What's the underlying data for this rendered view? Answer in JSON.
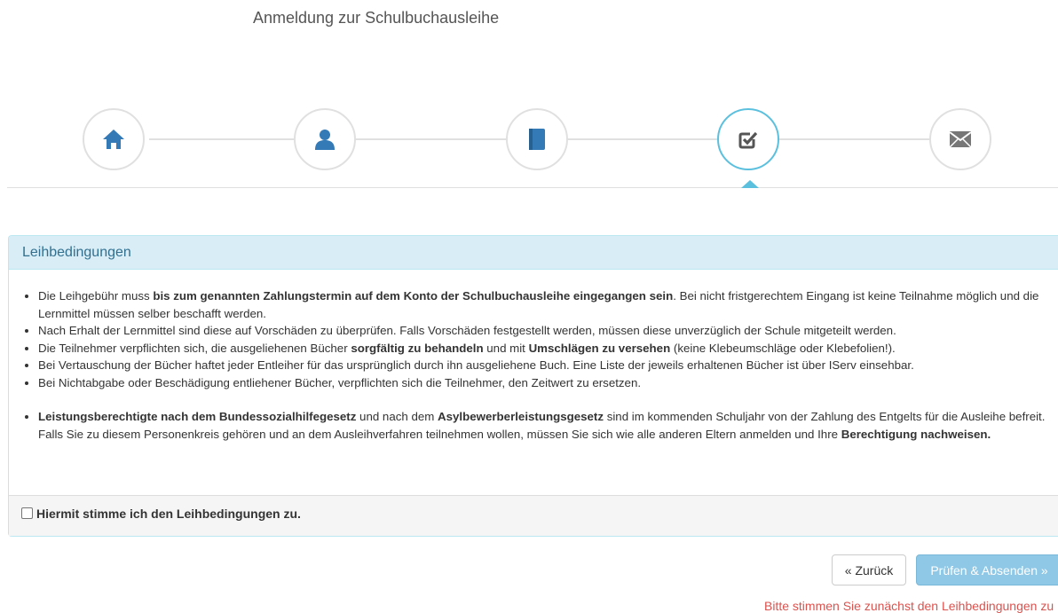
{
  "page": {
    "title": "Anmeldung zur Schulbuchausleihe"
  },
  "wizard": {
    "steps": [
      {
        "icon": "home-icon",
        "active": false
      },
      {
        "icon": "user-icon",
        "active": false
      },
      {
        "icon": "book-icon",
        "active": false
      },
      {
        "icon": "check-square-icon",
        "active": true
      },
      {
        "icon": "envelope-icon",
        "active": false
      }
    ],
    "colors": {
      "active": "#5bc0de",
      "icon": "#337ab7",
      "inactive_border": "#e0e0e0"
    }
  },
  "panel": {
    "heading": "Leihbedingungen",
    "items": [
      {
        "t1": "Die Leihgebühr muss ",
        "b1": "bis zum genannten Zahlungstermin auf dem Konto der Schulbuchausleihe eingegangen sein",
        "t2": ". Bei nicht fristgerechtem Eingang ist keine Teilnahme möglich und die Lernmittel müssen selber beschafft werden."
      },
      {
        "t1": "Nach Erhalt der Lernmittel sind diese auf Vorschäden zu überprüfen. Falls Vorschäden festgestellt werden, müssen diese unverzüglich der Schule mitgeteilt werden."
      },
      {
        "t1": "Die Teilnehmer verpflichten sich, die ausgeliehenen Bücher ",
        "b1": "sorgfältig zu behandeln",
        "t2": " und mit ",
        "b2": "Umschlägen zu versehen",
        "t3": " (keine Klebeumschläge oder Klebefolien!)."
      },
      {
        "t1": "Bei Vertauschung der Bücher haftet jeder Entleiher für das ursprünglich durch ihn ausgeliehene Buch. Eine Liste der jeweils erhaltenen Bücher ist über IServ einsehbar."
      },
      {
        "t1": "Bei Nichtabgabe oder Beschädigung entliehener Bücher, verpflichten sich die Teilnehmer, den Zeitwert zu ersetzen."
      }
    ],
    "note": {
      "b1": "Leistungsberechtigte nach dem Bundessozialhilfegesetz",
      "t1": " und nach dem ",
      "b2": "Asylbewerberleistungsgesetz",
      "t2": " sind im kommenden Schuljahr von der Zahlung des Entgelts für die Ausleihe befreit. Falls Sie zu diesem Personenkreis gehören und an dem Ausleihverfahren teilnehmen wollen, müssen Sie sich wie alle anderen Eltern anmelden und Ihre ",
      "b3": "Berechtigung nachweisen."
    },
    "agree_label": "Hiermit stimme ich den Leihbedingungen zu.",
    "agree_checked": false
  },
  "buttons": {
    "back": "« Zurück",
    "submit": "Prüfen & Absenden »"
  },
  "error": "Bitte stimmen Sie zunächst den Leihbedingungen zu"
}
